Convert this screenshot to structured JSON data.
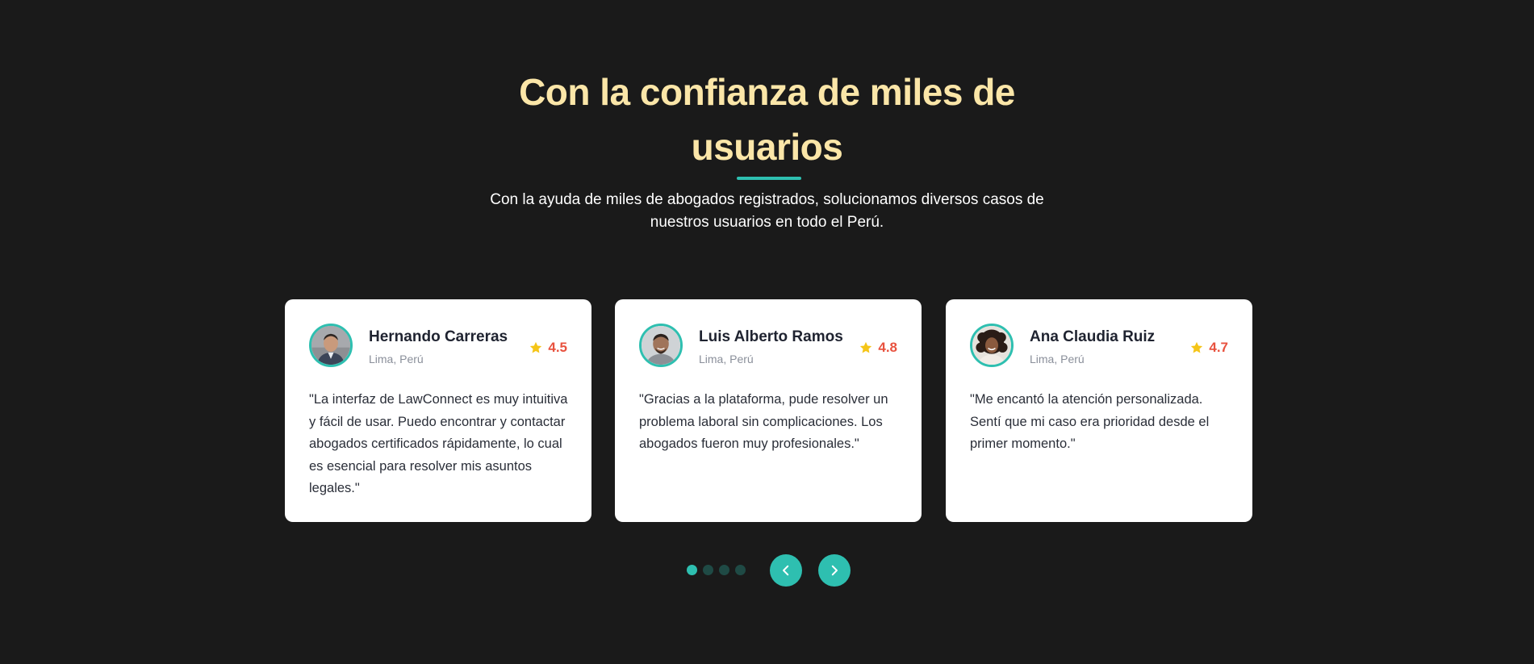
{
  "section": {
    "title_line1": "Con la confianza de miles de",
    "title_line2": "usuarios",
    "subtitle": "Con la ayuda de miles de abogados registrados, solucionamos diversos casos de nuestros usuarios en todo el Perú."
  },
  "testimonials": [
    {
      "name": "Hernando Carreras",
      "location": "Lima, Perú",
      "rating": "4.5",
      "quote": "\"La interfaz de LawConnect es muy intuitiva y fácil de usar. Puedo encontrar y contactar abogados certificados rápidamente, lo cual es esencial para resolver mis asuntos legales.\""
    },
    {
      "name": "Luis Alberto Ramos",
      "location": "Lima, Perú",
      "rating": "4.8",
      "quote": "\"Gracias a la plataforma, pude resolver un problema laboral sin complicaciones. Los abogados fueron muy profesionales.\""
    },
    {
      "name": "Ana Claudia Ruiz",
      "location": "Lima, Perú",
      "rating": "4.7",
      "quote": "\"Me encantó la atención personalizada. Sentí que mi caso era prioridad desde el primer momento.\""
    }
  ],
  "carousel": {
    "page_count": 4,
    "active_page": 1,
    "prev_icon": "chevron-left-icon",
    "next_icon": "chevron-right-icon"
  },
  "colors": {
    "background": "#1a1a1a",
    "title": "#fbe6a8",
    "accent": "#2ebfb0",
    "rating": "#e8523f",
    "star": "#f5c518",
    "dot_inactive": "#1f4a45"
  },
  "icons": {
    "rating": "star-icon",
    "avatar": "avatar"
  }
}
